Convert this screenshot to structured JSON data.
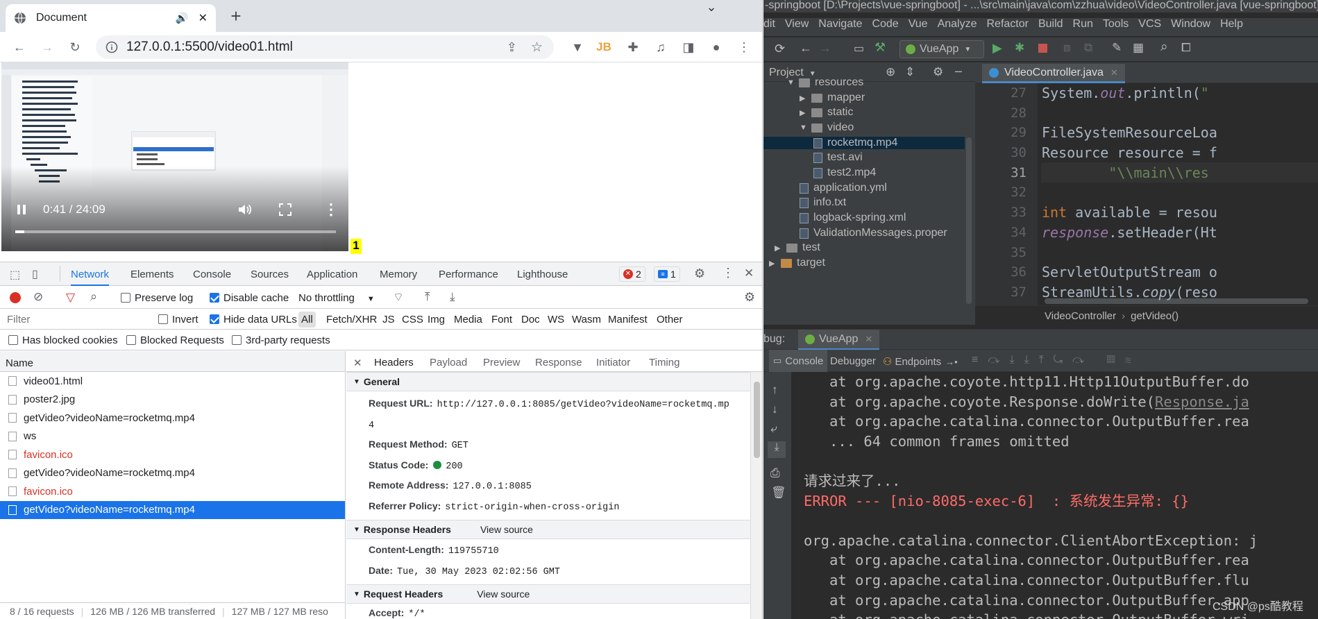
{
  "chrome": {
    "tab_title": "Document",
    "url": "127.0.0.1:5500/video01.html",
    "new_tab": "+",
    "win_min": "⌄",
    "win_max": "☐",
    "win_close": "✕"
  },
  "video": {
    "time": "0:41 / 24:09",
    "progress": 0.028,
    "marker": "1"
  },
  "devtools": {
    "tabs": [
      "Network",
      "Elements",
      "Console",
      "Sources",
      "Application",
      "Memory",
      "Performance",
      "Lighthouse"
    ],
    "active_tab": "Network",
    "errors": "2",
    "messages": "1",
    "preserve_log": "Preserve log",
    "disable_cache": "Disable cache",
    "throttling": "No throttling",
    "filter_placeholder": "Filter",
    "invert": "Invert",
    "hide_data_urls": "Hide data URLs",
    "types": [
      "All",
      "Fetch/XHR",
      "JS",
      "CSS",
      "Img",
      "Media",
      "Font",
      "Doc",
      "WS",
      "Wasm",
      "Manifest",
      "Other"
    ],
    "blocked_cookies": "Has blocked cookies",
    "blocked_requests": "Blocked Requests",
    "third_party": "3rd-party requests",
    "name_header": "Name",
    "requests": [
      {
        "name": "video01.html",
        "state": "normal"
      },
      {
        "name": "poster2.jpg",
        "state": "normal"
      },
      {
        "name": "getVideo?videoName=rocketmq.mp4",
        "state": "normal"
      },
      {
        "name": "ws",
        "state": "normal"
      },
      {
        "name": "favicon.ico",
        "state": "error"
      },
      {
        "name": "getVideo?videoName=rocketmq.mp4",
        "state": "normal"
      },
      {
        "name": "favicon.ico",
        "state": "error"
      },
      {
        "name": "getVideo?videoName=rocketmq.mp4",
        "state": "selected"
      }
    ],
    "footer": [
      "8 / 16 requests",
      "126 MB / 126 MB transferred",
      "127 MB / 127 MB reso"
    ],
    "detail_tabs": [
      "Headers",
      "Payload",
      "Preview",
      "Response",
      "Initiator",
      "Timing"
    ],
    "close": "✕",
    "general_title": "General",
    "general": {
      "request_url_label": "Request URL:",
      "request_url": "http://127.0.0.1:8085/getVideo?videoName=rocketmq.mp",
      "request_url_cont": "4",
      "method_label": "Request Method:",
      "method": "GET",
      "status_label": "Status Code:",
      "status": "200",
      "remote_label": "Remote Address:",
      "remote": "127.0.0.1:8085",
      "referrer_label": "Referrer Policy:",
      "referrer": "strict-origin-when-cross-origin"
    },
    "response_title": "Response Headers",
    "view_source": "View source",
    "response": {
      "cl_label": "Content-Length:",
      "cl": "119755710",
      "date_label": "Date:",
      "date": "Tue, 30 May 2023 02:02:56 GMT"
    },
    "request_title": "Request Headers",
    "accept_label": "Accept:",
    "accept": "*/*"
  },
  "ide": {
    "title": "-springboot [D:\\Projects\\vue-springboot] - ...\\src\\main\\java\\com\\zzhua\\video\\VideoController.java [vue-springboot]",
    "menu": [
      "dit",
      "View",
      "Navigate",
      "Code",
      "Vue",
      "Analyze",
      "Refactor",
      "Build",
      "Run",
      "Tools",
      "VCS",
      "Window",
      "Help"
    ],
    "run_config": "VueApp",
    "project_label": "Project",
    "tree": [
      {
        "label": "resources",
        "kind": "folder-open",
        "indent": 0
      },
      {
        "label": "mapper",
        "kind": "folder",
        "indent": 1
      },
      {
        "label": "static",
        "kind": "folder",
        "indent": 1
      },
      {
        "label": "video",
        "kind": "folder-open",
        "indent": 1
      },
      {
        "label": "rocketmq.mp4",
        "kind": "file",
        "indent": 2
      },
      {
        "label": "test.avi",
        "kind": "file",
        "indent": 2
      },
      {
        "label": "test2.mp4",
        "kind": "file",
        "indent": 2
      },
      {
        "label": "application.yml",
        "kind": "file",
        "indent": 1
      },
      {
        "label": "info.txt",
        "kind": "file",
        "indent": 1
      },
      {
        "label": "logback-spring.xml",
        "kind": "file",
        "indent": 1
      },
      {
        "label": "ValidationMessages.proper",
        "kind": "file",
        "indent": 1
      },
      {
        "label": "test",
        "kind": "folder",
        "indent": -1
      },
      {
        "label": "target",
        "kind": "folder-orange",
        "indent": -2
      }
    ],
    "editor_tab": "VideoController.java",
    "line_numbers": [
      "27",
      "28",
      "29",
      "30",
      "31",
      "32",
      "33",
      "34",
      "35",
      "36",
      "37"
    ],
    "code": [
      "System.out.println(\"",
      "",
      "FileSystemResourceLoa",
      "Resource resource = f",
      "        \"\\\\main\\\\res",
      "",
      "int available = resou",
      "response.setHeader(Ht",
      "",
      "ServletOutputStream o",
      "StreamUtils.copy(reso"
    ],
    "breadcrumb": [
      "VideoController",
      "getVideo()"
    ],
    "debug_label": "bug:",
    "debug_config": "VueApp",
    "debug_tabs": [
      "Console",
      "Debugger",
      "Endpoints"
    ],
    "console": [
      {
        "text": "   at org.apache.coyote.http11.Http11OutputBuffer.do",
        "kind": "normal"
      },
      {
        "text": "   at org.apache.coyote.Response.doWrite(",
        "link": "Response.ja",
        "kind": "link"
      },
      {
        "text": "   at org.apache.catalina.connector.OutputBuffer.rea",
        "kind": "normal"
      },
      {
        "text": "   ... 64 common frames omitted",
        "kind": "normal"
      },
      {
        "text": "",
        "kind": "normal"
      },
      {
        "text": "请求过来了...",
        "kind": "normal"
      },
      {
        "text": "ERROR --- [nio-8085-exec-6]  : 系统发生异常: {}",
        "kind": "error"
      },
      {
        "text": "",
        "kind": "normal"
      },
      {
        "text": "org.apache.catalina.connector.ClientAbortException: j",
        "kind": "normal"
      },
      {
        "text": "   at org.apache.catalina.connector.OutputBuffer.rea",
        "kind": "normal"
      },
      {
        "text": "   at org.apache.catalina.connector.OutputBuffer.flu",
        "kind": "normal"
      },
      {
        "text": "   at org.apache.catalina.connector.OutputBuffer.app",
        "kind": "normal"
      },
      {
        "text": "   at org.apache.catalina.connector.OutputBuffer.wri",
        "kind": "normal"
      }
    ],
    "watermark": "CSDN @ps酷教程"
  }
}
